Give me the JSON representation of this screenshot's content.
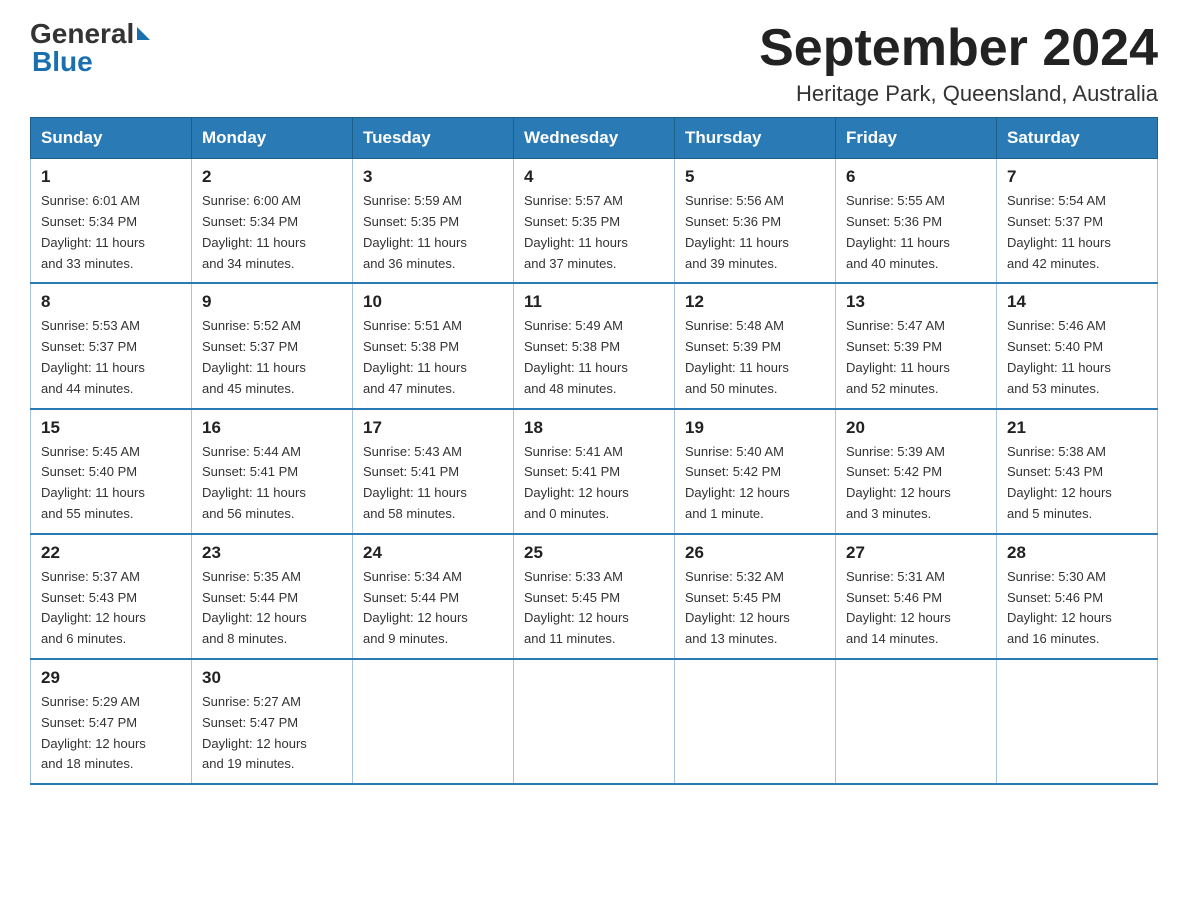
{
  "header": {
    "logo_general": "General",
    "logo_blue": "Blue",
    "title": "September 2024",
    "subtitle": "Heritage Park, Queensland, Australia"
  },
  "days_of_week": [
    "Sunday",
    "Monday",
    "Tuesday",
    "Wednesday",
    "Thursday",
    "Friday",
    "Saturday"
  ],
  "weeks": [
    [
      {
        "day": "1",
        "sunrise": "6:01 AM",
        "sunset": "5:34 PM",
        "daylight": "11 hours and 33 minutes."
      },
      {
        "day": "2",
        "sunrise": "6:00 AM",
        "sunset": "5:34 PM",
        "daylight": "11 hours and 34 minutes."
      },
      {
        "day": "3",
        "sunrise": "5:59 AM",
        "sunset": "5:35 PM",
        "daylight": "11 hours and 36 minutes."
      },
      {
        "day": "4",
        "sunrise": "5:57 AM",
        "sunset": "5:35 PM",
        "daylight": "11 hours and 37 minutes."
      },
      {
        "day": "5",
        "sunrise": "5:56 AM",
        "sunset": "5:36 PM",
        "daylight": "11 hours and 39 minutes."
      },
      {
        "day": "6",
        "sunrise": "5:55 AM",
        "sunset": "5:36 PM",
        "daylight": "11 hours and 40 minutes."
      },
      {
        "day": "7",
        "sunrise": "5:54 AM",
        "sunset": "5:37 PM",
        "daylight": "11 hours and 42 minutes."
      }
    ],
    [
      {
        "day": "8",
        "sunrise": "5:53 AM",
        "sunset": "5:37 PM",
        "daylight": "11 hours and 44 minutes."
      },
      {
        "day": "9",
        "sunrise": "5:52 AM",
        "sunset": "5:37 PM",
        "daylight": "11 hours and 45 minutes."
      },
      {
        "day": "10",
        "sunrise": "5:51 AM",
        "sunset": "5:38 PM",
        "daylight": "11 hours and 47 minutes."
      },
      {
        "day": "11",
        "sunrise": "5:49 AM",
        "sunset": "5:38 PM",
        "daylight": "11 hours and 48 minutes."
      },
      {
        "day": "12",
        "sunrise": "5:48 AM",
        "sunset": "5:39 PM",
        "daylight": "11 hours and 50 minutes."
      },
      {
        "day": "13",
        "sunrise": "5:47 AM",
        "sunset": "5:39 PM",
        "daylight": "11 hours and 52 minutes."
      },
      {
        "day": "14",
        "sunrise": "5:46 AM",
        "sunset": "5:40 PM",
        "daylight": "11 hours and 53 minutes."
      }
    ],
    [
      {
        "day": "15",
        "sunrise": "5:45 AM",
        "sunset": "5:40 PM",
        "daylight": "11 hours and 55 minutes."
      },
      {
        "day": "16",
        "sunrise": "5:44 AM",
        "sunset": "5:41 PM",
        "daylight": "11 hours and 56 minutes."
      },
      {
        "day": "17",
        "sunrise": "5:43 AM",
        "sunset": "5:41 PM",
        "daylight": "11 hours and 58 minutes."
      },
      {
        "day": "18",
        "sunrise": "5:41 AM",
        "sunset": "5:41 PM",
        "daylight": "12 hours and 0 minutes."
      },
      {
        "day": "19",
        "sunrise": "5:40 AM",
        "sunset": "5:42 PM",
        "daylight": "12 hours and 1 minute."
      },
      {
        "day": "20",
        "sunrise": "5:39 AM",
        "sunset": "5:42 PM",
        "daylight": "12 hours and 3 minutes."
      },
      {
        "day": "21",
        "sunrise": "5:38 AM",
        "sunset": "5:43 PM",
        "daylight": "12 hours and 5 minutes."
      }
    ],
    [
      {
        "day": "22",
        "sunrise": "5:37 AM",
        "sunset": "5:43 PM",
        "daylight": "12 hours and 6 minutes."
      },
      {
        "day": "23",
        "sunrise": "5:35 AM",
        "sunset": "5:44 PM",
        "daylight": "12 hours and 8 minutes."
      },
      {
        "day": "24",
        "sunrise": "5:34 AM",
        "sunset": "5:44 PM",
        "daylight": "12 hours and 9 minutes."
      },
      {
        "day": "25",
        "sunrise": "5:33 AM",
        "sunset": "5:45 PM",
        "daylight": "12 hours and 11 minutes."
      },
      {
        "day": "26",
        "sunrise": "5:32 AM",
        "sunset": "5:45 PM",
        "daylight": "12 hours and 13 minutes."
      },
      {
        "day": "27",
        "sunrise": "5:31 AM",
        "sunset": "5:46 PM",
        "daylight": "12 hours and 14 minutes."
      },
      {
        "day": "28",
        "sunrise": "5:30 AM",
        "sunset": "5:46 PM",
        "daylight": "12 hours and 16 minutes."
      }
    ],
    [
      {
        "day": "29",
        "sunrise": "5:29 AM",
        "sunset": "5:47 PM",
        "daylight": "12 hours and 18 minutes."
      },
      {
        "day": "30",
        "sunrise": "5:27 AM",
        "sunset": "5:47 PM",
        "daylight": "12 hours and 19 minutes."
      },
      null,
      null,
      null,
      null,
      null
    ]
  ],
  "labels": {
    "sunrise": "Sunrise:",
    "sunset": "Sunset:",
    "daylight": "Daylight:"
  }
}
